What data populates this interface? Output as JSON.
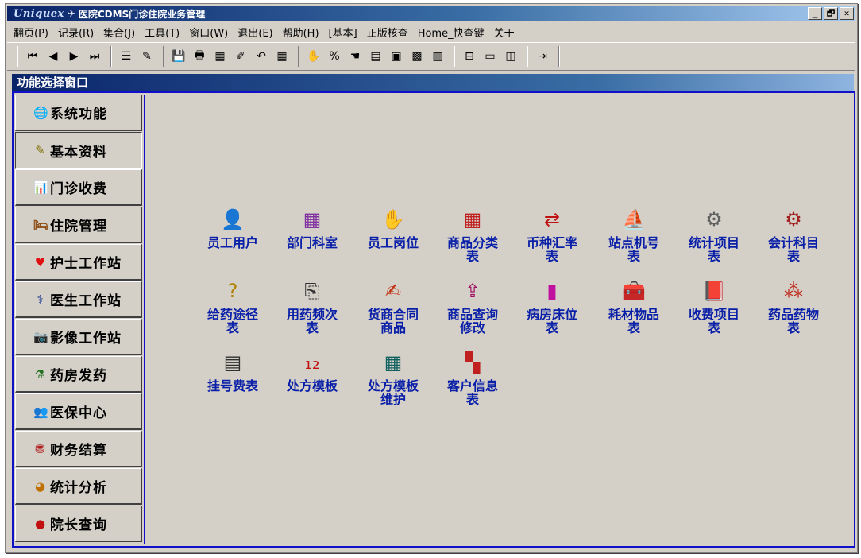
{
  "window": {
    "logo": "Uniquex",
    "title": "医院CDMS门诊住院业务管理",
    "buttons": {
      "minimize": "_",
      "restore": "🗗",
      "close": "✕"
    }
  },
  "menubar": [
    "翻页(P)",
    "记录(R)",
    "集合(J)",
    "工具(T)",
    "窗口(W)",
    "退出(E)",
    "帮助(H)",
    "[基本]",
    "正版核查",
    "Home_快查键",
    "关于"
  ],
  "toolbar": {
    "groups": [
      [
        "first-record-icon|⏮",
        "prev-record-icon|◀",
        "next-record-icon|▶",
        "last-record-icon|⏭"
      ],
      [
        "filter-icon|☰",
        "brush-icon|✎"
      ],
      [
        "save-icon|💾",
        "print-icon|🖶",
        "table-icon|▦",
        "edit-icon|✐",
        "undo-icon|↶",
        "grid-icon|▦"
      ],
      [
        "tool-icon|✋",
        "percent-icon|%",
        "hand-icon|☚",
        "calc-icon|▤",
        "calc2-icon|▣",
        "box-icon|▩",
        "form-icon|▥"
      ],
      [
        "tree-icon|⊟",
        "window-icon|▭",
        "tile-icon|◫"
      ],
      [
        "exit-door-icon|⇥"
      ]
    ]
  },
  "panel": {
    "title": "功能选择窗口"
  },
  "sidebar": [
    {
      "label": "系统功能",
      "icon": "globe-icon",
      "glyph": "🌐",
      "color": "#2b5fb0",
      "active": false
    },
    {
      "label": "基本资料",
      "icon": "eraser-icon",
      "glyph": "✎",
      "color": "#807000",
      "active": true
    },
    {
      "label": "门诊收费",
      "icon": "chart-icon",
      "glyph": "📊",
      "color": "#1a5ab0",
      "active": false
    },
    {
      "label": "住院管理",
      "icon": "bed-icon",
      "glyph": "🛏",
      "color": "#8a4a10",
      "active": false
    },
    {
      "label": "护士工作站",
      "icon": "heart-icon",
      "glyph": "♥",
      "color": "#e01010",
      "active": false
    },
    {
      "label": "医生工作站",
      "icon": "doctor-icon",
      "glyph": "⚕",
      "color": "#204090",
      "active": false
    },
    {
      "label": "影像工作站",
      "icon": "camera-icon",
      "glyph": "📷",
      "color": "#404040",
      "active": false
    },
    {
      "label": "药房发药",
      "icon": "flask-icon",
      "glyph": "⚗",
      "color": "#207020",
      "active": false
    },
    {
      "label": "医保中心",
      "icon": "people-icon",
      "glyph": "👥",
      "color": "#404040",
      "active": false
    },
    {
      "label": "财务结算",
      "icon": "coins-icon",
      "glyph": "⛃",
      "color": "#b02020",
      "active": false
    },
    {
      "label": "统计分析",
      "icon": "pie-icon",
      "glyph": "◕",
      "color": "#c07000",
      "active": false
    },
    {
      "label": "院长查询",
      "icon": "apple-icon",
      "glyph": "●",
      "color": "#c01010",
      "active": false
    }
  ],
  "content_items": [
    {
      "label": "员工用户",
      "icon": "staff-user-icon",
      "glyph": "👤",
      "color": "#d07010"
    },
    {
      "label": "部门科室",
      "icon": "department-icon",
      "glyph": "▦",
      "color": "#8030a0"
    },
    {
      "label": "员工岗位",
      "icon": "glove-icon",
      "glyph": "✋",
      "color": "#404040"
    },
    {
      "label": "商品分类表",
      "icon": "category-grid-icon",
      "glyph": "▦",
      "color": "#c02020"
    },
    {
      "label": "币种汇率表",
      "icon": "currency-icon",
      "glyph": "⇄",
      "color": "#c01010"
    },
    {
      "label": "站点机号表",
      "icon": "station-icon",
      "glyph": "⛵",
      "color": "#106090"
    },
    {
      "label": "统计项目表",
      "icon": "stats-item-icon",
      "glyph": "⚙",
      "color": "#606060"
    },
    {
      "label": "会计科目表",
      "icon": "account-icon",
      "glyph": "⚙",
      "color": "#a02020"
    },
    {
      "label": "给药途径表",
      "icon": "route-icon",
      "glyph": "?",
      "color": "#b08000"
    },
    {
      "label": "用药频次表",
      "icon": "frequency-icon",
      "glyph": "⎘",
      "color": "#303030"
    },
    {
      "label": "货商合同商品",
      "icon": "contract-icon",
      "glyph": "✍",
      "color": "#c03010"
    },
    {
      "label": "商品查询修改",
      "icon": "query-icon",
      "glyph": "⇪",
      "color": "#a01060"
    },
    {
      "label": "病房床位表",
      "icon": "ward-bed-icon",
      "glyph": "▮",
      "color": "#c010a0"
    },
    {
      "label": "耗材物品表",
      "icon": "supplies-icon",
      "glyph": "🧰",
      "color": "#507020"
    },
    {
      "label": "收费项目表",
      "icon": "fee-book-icon",
      "glyph": "📕",
      "color": "#8020a0"
    },
    {
      "label": "药品药物表",
      "icon": "medicine-icon",
      "glyph": "⁂",
      "color": "#c03020"
    },
    {
      "label": "挂号费表",
      "icon": "registration-icon",
      "glyph": "▤",
      "color": "#303030"
    },
    {
      "label": "处方模板",
      "icon": "prescription-icon",
      "glyph": "₁₂",
      "color": "#c01010"
    },
    {
      "label": "处方模板维护",
      "icon": "template-maint-icon",
      "glyph": "▦",
      "color": "#106060"
    },
    {
      "label": "客户信息表",
      "icon": "customer-icon",
      "glyph": "▚",
      "color": "#c02020"
    }
  ]
}
